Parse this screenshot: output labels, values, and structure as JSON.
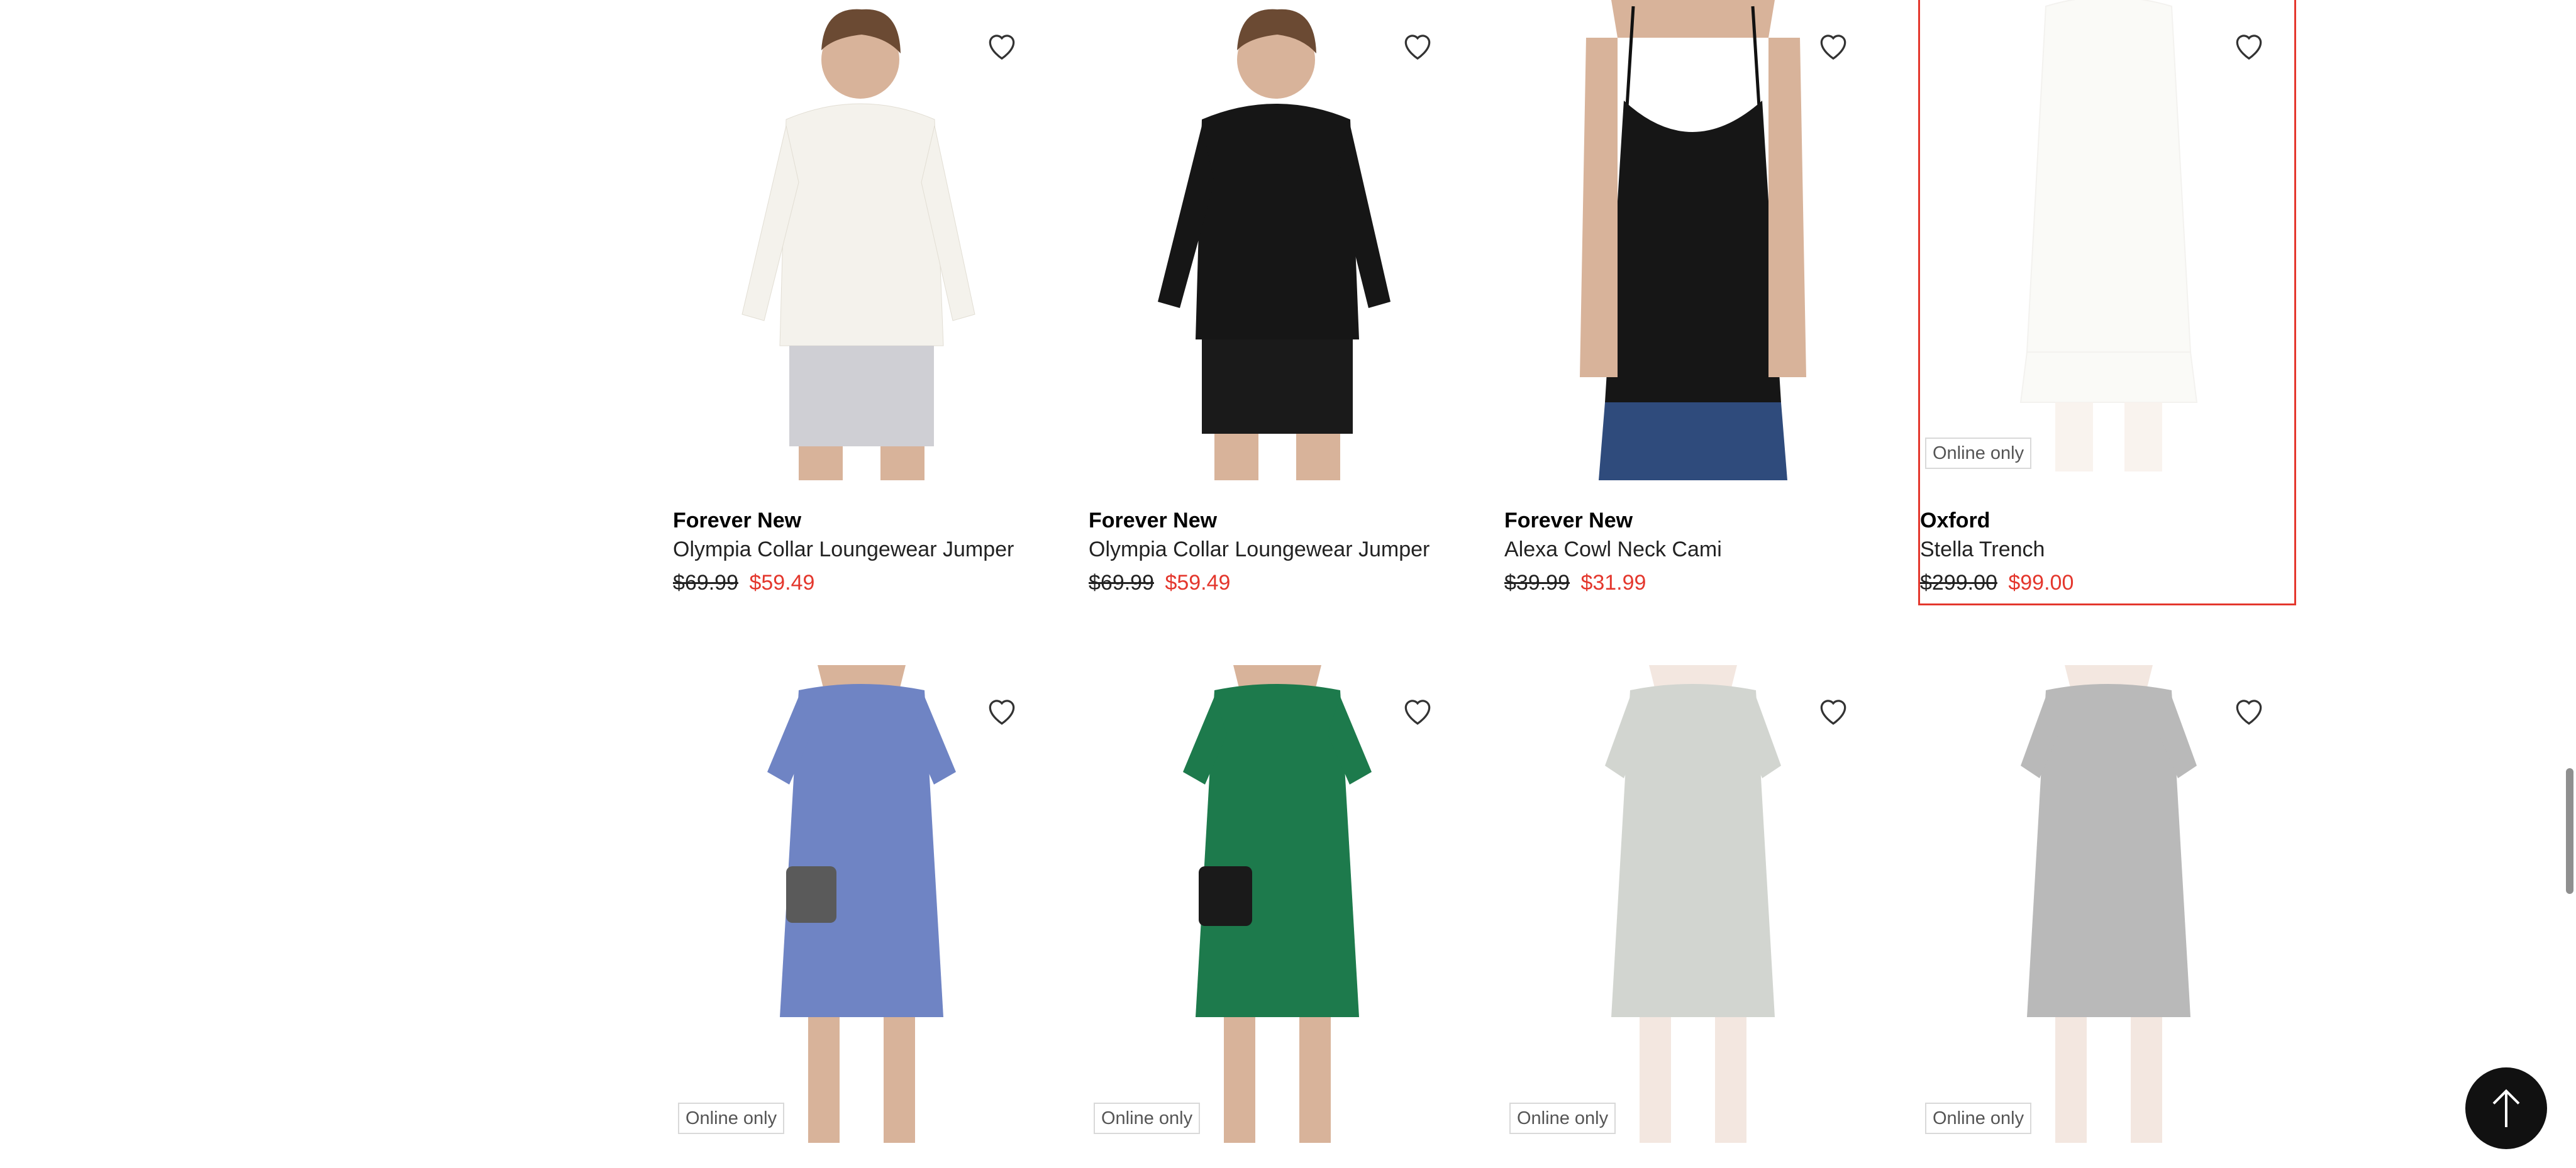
{
  "products": [
    {
      "brand": "Forever New",
      "name": "Olympia Collar Loungewear Jumper",
      "was": "$69.99",
      "now": "$59.49"
    },
    {
      "brand": "Forever New",
      "name": "Olympia Collar Loungewear Jumper",
      "was": "$69.99",
      "now": "$59.49"
    },
    {
      "brand": "Forever New",
      "name": "Alexa Cowl Neck Cami",
      "was": "$39.99",
      "now": "$31.99"
    },
    {
      "brand": "Oxford",
      "name": "Stella Trench",
      "was": "$299.00",
      "now": "$99.00",
      "badge": "Online only"
    },
    {
      "badge": "Online only"
    },
    {
      "badge": "Online only"
    },
    {
      "badge": "Online only"
    },
    {
      "badge": "Online only"
    }
  ],
  "colors": {
    "sale": "#e4372d",
    "selection_outline": "#e4372d",
    "back_to_top": "#111111"
  },
  "icons": {
    "wishlist": "heart-outline-icon",
    "back_to_top": "arrow-up-icon"
  }
}
